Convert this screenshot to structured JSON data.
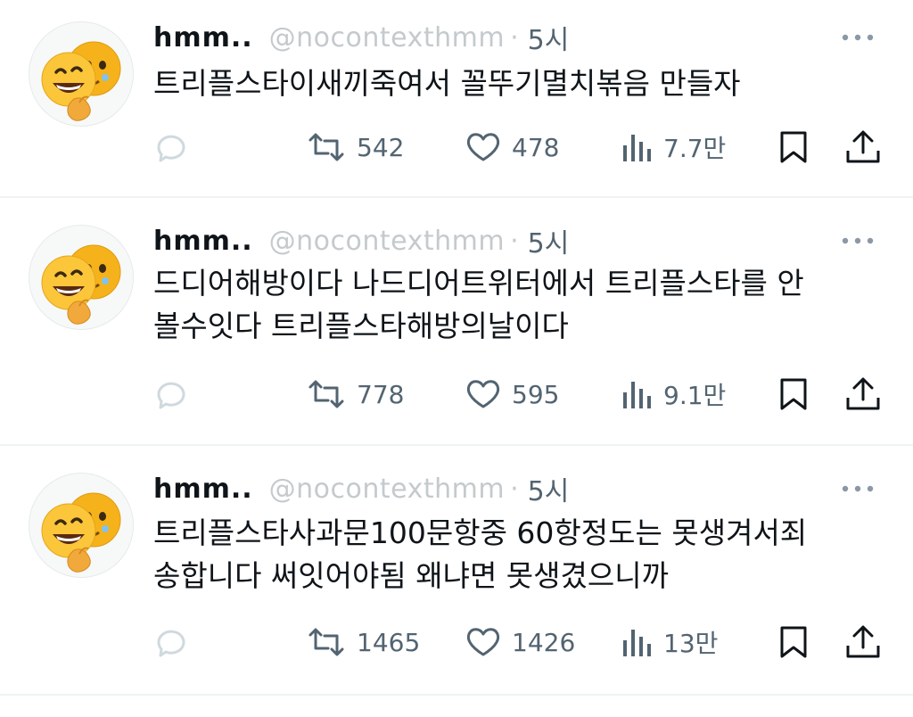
{
  "tweets": [
    {
      "name": "hmm..",
      "handle": "@nocontexthmm",
      "time": "5시",
      "text": "트리플스타이새끼죽여서 꼴뚜기멸치볶음 만들자",
      "replies": "",
      "retweets": "542",
      "likes": "478",
      "views": "7.7만"
    },
    {
      "name": "hmm..",
      "handle": "@nocontexthmm",
      "time": "5시",
      "text": "드디어해방이다  나드디어트위터에서 트리플스타를 안\n볼수잇다  트리플스타해방의날이다",
      "replies": "",
      "retweets": "778",
      "likes": "595",
      "views": "9.1만"
    },
    {
      "name": "hmm..",
      "handle": "@nocontexthmm",
      "time": "5시",
      "text": "트리플스타사과문100문항중 60항정도는 못생겨서죄\n송합니다 써잇어야됨  왜냐면 못생겼으니까",
      "replies": "",
      "retweets": "1465",
      "likes": "1426",
      "views": "13만"
    }
  ],
  "icons": {
    "reply": "reply-bubble-icon",
    "retweet": "retweet-icon",
    "like": "heart-icon",
    "views": "views-bar-chart-icon",
    "bookmark": "bookmark-icon",
    "share": "share-upload-icon",
    "more": "more-dots-icon",
    "avatar": "peeking-face-emoji-avatar"
  },
  "colors": {
    "text": "#0f1419",
    "muted": "#536471",
    "divider": "#eff3f4",
    "reply_icon": "#cfd9de"
  }
}
